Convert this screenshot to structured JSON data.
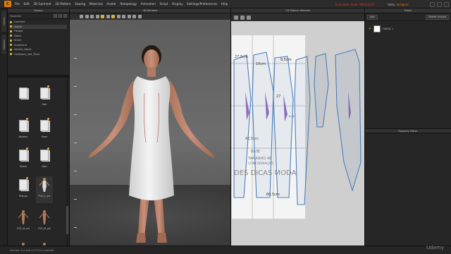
{
  "menu": {
    "items": [
      "File",
      "Edit",
      "3D Garment",
      "2D Pattern",
      "Sewing",
      "Materials",
      "Avatar",
      "Retopology",
      "Animation",
      "Script",
      "Display",
      "Settings/Preferences",
      "Help"
    ],
    "trial": "Evaluation Date: 0601/2022",
    "user_prefix": "Hello,",
    "user_name": "designer"
  },
  "side_tabs": [
    "Library",
    "Modular"
  ],
  "library": {
    "title": "Library",
    "favorites_label": "Favorites",
    "favorites": [
      "Garment",
      "Avatar",
      "Hanger",
      "Fabric",
      "Stitch",
      "Substance",
      "Interior_Fabric",
      "Hardware_and_Trims"
    ],
    "grid": [
      "Hair",
      "Modern",
      "Pose",
      "Shoes",
      "Size",
      "Texture",
      "FV2_C_sct",
      "FV2_M_sct",
      "FV2_M_sct"
    ]
  },
  "window3d": {
    "title": "3D Window"
  },
  "window2d": {
    "title": "2D Pattern Window",
    "measurements": [
      "27,5cm",
      "10cm",
      "8,5cm",
      "27",
      "0,12",
      "42,5cm",
      "BASE",
      "TAMANHO 48",
      "CONFORMAÇÃO",
      "DES DICAS MODA",
      "60,5cm"
    ]
  },
  "fabric": {
    "title": "Fabric",
    "buttons": [
      "Add",
      "Delete Unused"
    ],
    "items": [
      {
        "name": "FABRIC 1",
        "color": "#ffffff"
      }
    ]
  },
  "property_editor": {
    "title": "Property Editor"
  },
  "status": {
    "text": "Version: 6.1.440 (177122)   Untitled"
  },
  "watermark": "Udemy",
  "colors": {
    "accent": "#e07b00",
    "trial": "#e0312a",
    "pattern_line": "#4a7fc0"
  }
}
